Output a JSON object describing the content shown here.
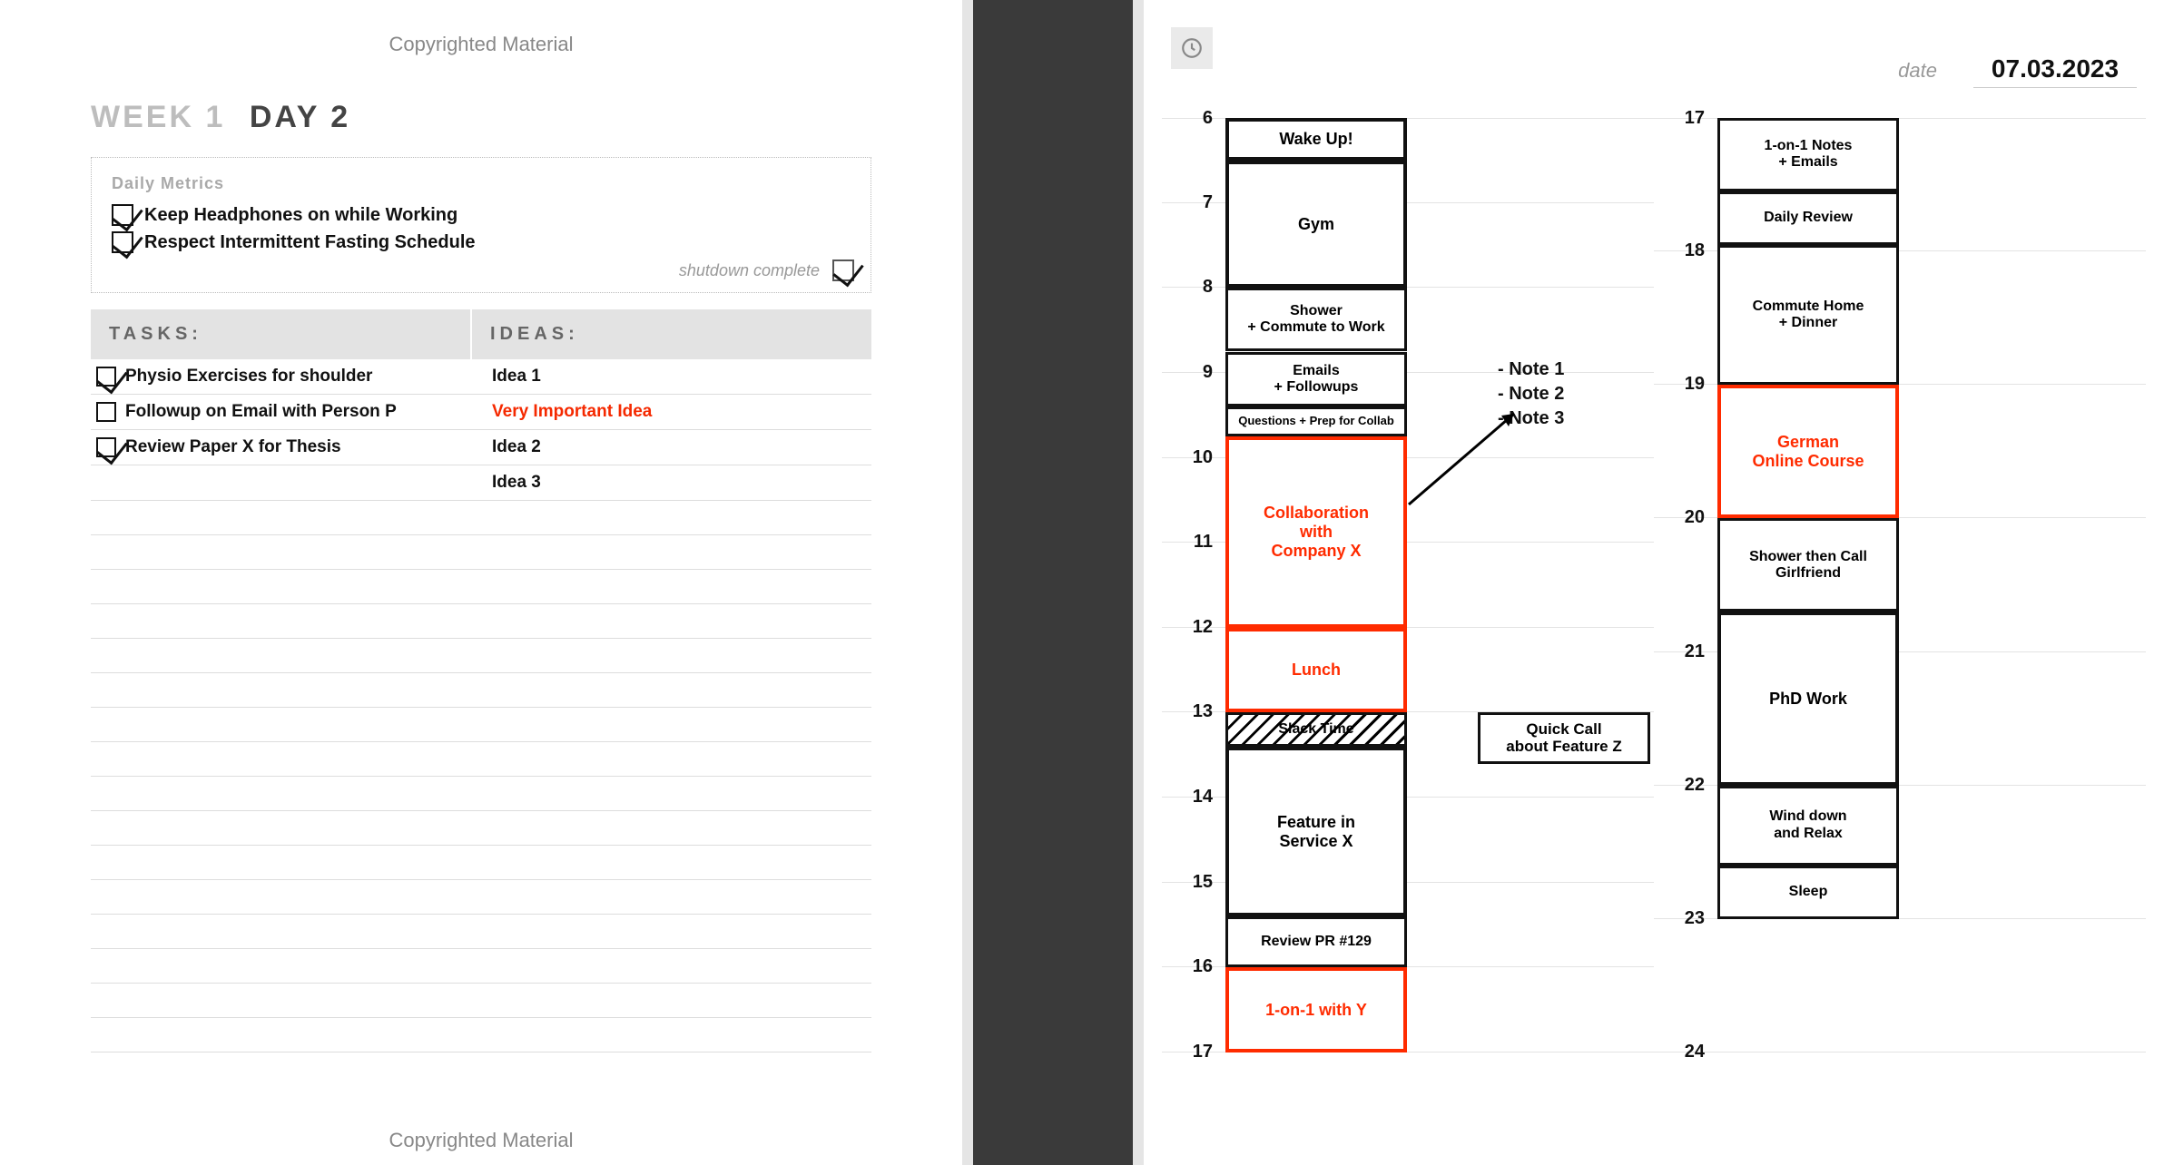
{
  "left": {
    "copyright": "Copyrighted Material",
    "week_label": "WEEK 1",
    "day_label": "DAY 2",
    "metrics": {
      "title": "Daily Metrics",
      "items": [
        {
          "label": "Keep Headphones on while Working",
          "checked": true
        },
        {
          "label": "Respect Intermittent Fasting Schedule",
          "checked": true
        }
      ],
      "shutdown_label": "shutdown complete",
      "shutdown_checked": true
    },
    "headers": {
      "tasks": "TASKS:",
      "ideas": "IDEAS:"
    },
    "rows": [
      {
        "task": {
          "label": "Physio Exercises for shoulder",
          "checked": true
        },
        "idea": {
          "label": "Idea 1",
          "red": false
        }
      },
      {
        "task": {
          "label": "Followup on Email with Person P",
          "checked": false
        },
        "idea": {
          "label": "Very Important Idea",
          "red": true
        }
      },
      {
        "task": {
          "label": "Review Paper X for Thesis",
          "checked": true
        },
        "idea": {
          "label": "Idea 2",
          "red": false
        }
      },
      {
        "task": null,
        "idea": {
          "label": "Idea 3",
          "red": false
        }
      }
    ]
  },
  "right": {
    "date_label": "date",
    "date_value": "07.03.2023",
    "col1_hours": [
      "6",
      "7",
      "8",
      "9",
      "10",
      "11",
      "12",
      "13",
      "14",
      "15",
      "16",
      "17"
    ],
    "col2_hours": [
      "17",
      "18",
      "19",
      "20",
      "21",
      "22",
      "23",
      "24"
    ],
    "col1_blocks": [
      {
        "label": "Wake Up!",
        "from": 6,
        "to": 6.5,
        "style": ""
      },
      {
        "label": "Gym",
        "from": 6.5,
        "to": 8,
        "style": ""
      },
      {
        "label": "Shower\n+ Commute to Work",
        "from": 8,
        "to": 8.75,
        "style": "thin"
      },
      {
        "label": "Emails\n+ Followups",
        "from": 8.75,
        "to": 9.4,
        "style": "thin"
      },
      {
        "label": "Questions + Prep for Collab",
        "from": 9.4,
        "to": 9.75,
        "style": "thin small"
      },
      {
        "label": "Collaboration\nwith\nCompany X",
        "from": 9.75,
        "to": 12,
        "style": "red"
      },
      {
        "label": "Lunch",
        "from": 12,
        "to": 13,
        "style": "red"
      },
      {
        "label": "Slack Time",
        "from": 13,
        "to": 13.4,
        "style": "hatched thin"
      },
      {
        "label": "Feature in\nService X",
        "from": 13.4,
        "to": 15.4,
        "style": ""
      },
      {
        "label": "Review PR #129",
        "from": 15.4,
        "to": 16,
        "style": "thin"
      },
      {
        "label": "1-on-1 with Y",
        "from": 16,
        "to": 17,
        "style": "red"
      }
    ],
    "col1_side": {
      "label": "Quick Call\nabout Feature Z",
      "from": 13,
      "to": 13.6
    },
    "col2_blocks": [
      {
        "label": "1-on-1 Notes\n+ Emails",
        "from": 17,
        "to": 17.55,
        "style": "thin"
      },
      {
        "label": "Daily Review",
        "from": 17.55,
        "to": 17.95,
        "style": "thin"
      },
      {
        "label": "Commute Home\n+ Dinner",
        "from": 17.95,
        "to": 19,
        "style": "thin"
      },
      {
        "label": "German\nOnline Course",
        "from": 19,
        "to": 20,
        "style": "red"
      },
      {
        "label": "Shower then Call\nGirlfriend",
        "from": 20,
        "to": 20.7,
        "style": "thin"
      },
      {
        "label": "PhD Work",
        "from": 20.7,
        "to": 22,
        "style": ""
      },
      {
        "label": "Wind down\nand Relax",
        "from": 22,
        "to": 22.6,
        "style": "thin"
      },
      {
        "label": "Sleep",
        "from": 22.6,
        "to": 23,
        "style": "thin"
      }
    ],
    "notes": [
      "- Note 1",
      "- Note 2",
      "- Note 3"
    ]
  }
}
